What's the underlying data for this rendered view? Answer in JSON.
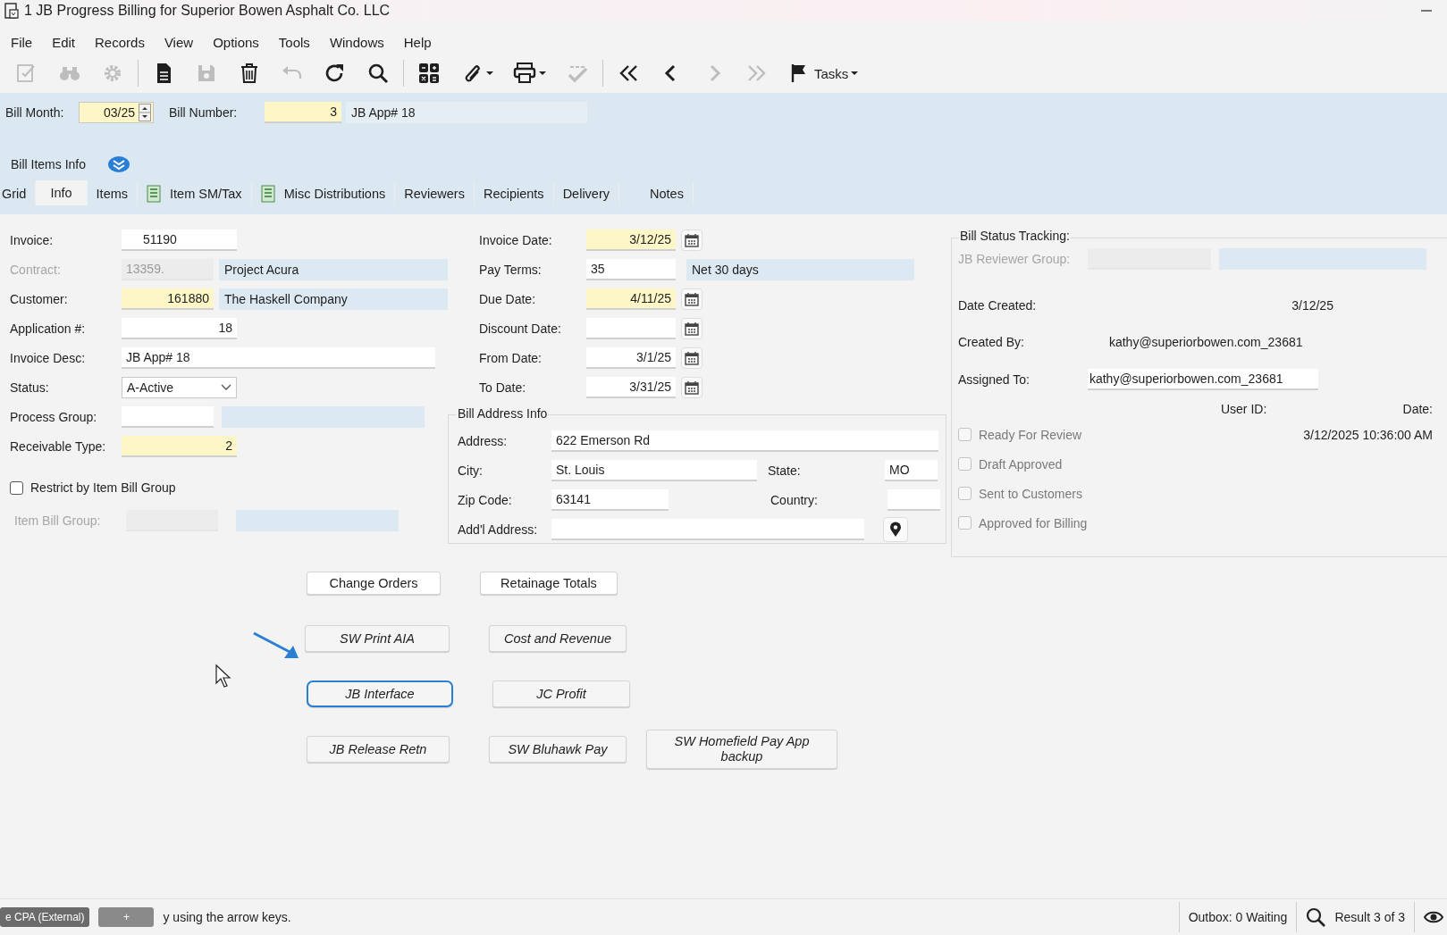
{
  "window": {
    "title": "1 JB Progress Billing for Superior Bowen  Asphalt Co. LLC"
  },
  "menu": [
    "File",
    "Edit",
    "Records",
    "View",
    "Options",
    "Tools",
    "Windows",
    "Help"
  ],
  "toolbar": [
    {
      "kind": "edit",
      "disabled": true,
      "dropdown": false
    },
    {
      "kind": "binoculars",
      "disabled": true,
      "dropdown": false
    },
    {
      "kind": "gear",
      "disabled": true,
      "dropdown": false
    },
    {
      "kind": "separator"
    },
    {
      "kind": "document",
      "disabled": false,
      "dropdown": false
    },
    {
      "kind": "save",
      "disabled": true,
      "dropdown": false
    },
    {
      "kind": "trash",
      "disabled": false,
      "dropdown": false
    },
    {
      "kind": "undo",
      "disabled": true,
      "dropdown": false
    },
    {
      "kind": "refresh",
      "disabled": false,
      "dropdown": false
    },
    {
      "kind": "search",
      "disabled": false,
      "dropdown": false
    },
    {
      "kind": "separator"
    },
    {
      "kind": "calculator",
      "disabled": false,
      "dropdown": false
    },
    {
      "kind": "attach",
      "disabled": false,
      "dropdown": true
    },
    {
      "kind": "print",
      "disabled": false,
      "dropdown": true
    },
    {
      "kind": "spellcheck",
      "disabled": true,
      "dropdown": false
    },
    {
      "kind": "separator"
    },
    {
      "kind": "first",
      "disabled": false,
      "dropdown": false
    },
    {
      "kind": "previous",
      "disabled": false,
      "dropdown": false
    },
    {
      "kind": "next",
      "disabled": true,
      "dropdown": false
    },
    {
      "kind": "last",
      "disabled": true,
      "dropdown": false
    },
    {
      "kind": "tasks",
      "label": "Tasks",
      "disabled": false,
      "dropdown": true
    }
  ],
  "header": {
    "bill_month": {
      "label": "Bill Month:",
      "value": "03/25"
    },
    "bill_number": {
      "label": "Bill Number:",
      "value": "3"
    },
    "description": "JB App# 18"
  },
  "section": {
    "title": "Bill Items Info"
  },
  "tabs": [
    {
      "label": "Grid",
      "selected": false,
      "icon": false
    },
    {
      "label": "Info",
      "selected": true,
      "icon": false
    },
    {
      "label": "Items",
      "selected": false,
      "icon": false
    },
    {
      "label": "Item SM/Tax",
      "selected": false,
      "icon": true
    },
    {
      "label": "Misc Distributions",
      "selected": false,
      "icon": true
    },
    {
      "label": "Reviewers",
      "selected": false,
      "icon": false
    },
    {
      "label": "Recipients",
      "selected": false,
      "icon": false
    },
    {
      "label": "Delivery",
      "selected": false,
      "icon": false
    },
    {
      "label": "Notes",
      "selected": false,
      "icon": false
    }
  ],
  "left_fields": [
    {
      "label": "Invoice:",
      "kind": "code",
      "value": "51190",
      "required": false,
      "disabled": false,
      "lookup": false
    },
    {
      "label": "Contract:",
      "kind": "text",
      "value": "13359.",
      "required": false,
      "disabled": true,
      "lookup": true,
      "description": "Project Acura"
    },
    {
      "label": "Customer:",
      "kind": "number",
      "value": "161880",
      "required": true,
      "disabled": false,
      "lookup": true,
      "description": "The Haskell Company"
    },
    {
      "label": "Application #:",
      "kind": "number",
      "value": "18",
      "required": false,
      "disabled": false,
      "lookup": false
    },
    {
      "label": "Invoice Desc:",
      "kind": "wide",
      "value": "JB App# 18",
      "required": false,
      "disabled": false,
      "lookup": false
    },
    {
      "label": "Status:",
      "kind": "select",
      "value": "A-Active",
      "required": false,
      "disabled": false,
      "lookup": false
    },
    {
      "label": "Process Group:",
      "required": false,
      "disabled": false,
      "lookup": true
    },
    {
      "label": "Receivable Type:",
      "kind": "number",
      "value": "2",
      "required": true,
      "disabled": false,
      "lookup": false
    }
  ],
  "restrict": {
    "label": "Restrict by Item Bill Group",
    "checked": false
  },
  "lower_fields": [
    {
      "label": "Item Bill Group:",
      "required": false,
      "disabled": true,
      "lookup": true
    }
  ],
  "middle_fields": [
    {
      "label": "Invoice Date:",
      "kind": "date",
      "value": "3/12/25",
      "required": true
    },
    {
      "label": "Pay Terms:",
      "kind": "text",
      "value": "35",
      "required": false,
      "description": "Net 30 days"
    },
    {
      "label": "Due Date:",
      "kind": "date",
      "value": "4/11/25",
      "required": true
    },
    {
      "label": "Discount Date:",
      "kind": "date",
      "required": false
    },
    {
      "label": "From Date:",
      "kind": "date",
      "value": "3/1/25",
      "required": false
    },
    {
      "label": "To Date:",
      "kind": "date",
      "value": "3/31/25",
      "required": false
    }
  ],
  "bill_address": {
    "title": "Bill Address Info",
    "address": {
      "label": "Address:",
      "value": "622 Emerson Rd"
    },
    "city": {
      "label": "City:",
      "value": "St. Louis"
    },
    "state": {
      "label": "State:",
      "value": "MO"
    },
    "zip": {
      "label": "Zip Code:",
      "value": "63141"
    },
    "country": {
      "label": "Country:"
    },
    "addl_address": {
      "label": "Add'l Address:"
    }
  },
  "status_tracking": {
    "title": "Bill Status Tracking:",
    "reviewer_group": {
      "label": "JB Reviewer Group:",
      "disabled": true
    },
    "date_created": {
      "label": "Date Created:",
      "value": "3/12/25"
    },
    "created_by": {
      "label": "Created By:",
      "value": "kathy@superiorbowen.com_23681"
    },
    "assigned_to": {
      "label": "Assigned To:",
      "value": "kathy@superiorbowen.com_23681"
    },
    "columns": [
      "User ID:",
      "Date:"
    ],
    "checks": [
      {
        "label": "Ready For Review",
        "checked": false,
        "disabled": true,
        "date": "3/12/2025 10:36:00 AM"
      },
      {
        "label": "Draft Approved",
        "checked": false,
        "disabled": true
      },
      {
        "label": "Sent to Customers",
        "checked": false,
        "disabled": true
      },
      {
        "label": "Approved for Billing",
        "checked": false,
        "disabled": true
      }
    ]
  },
  "buttons": [
    [
      {
        "label": "Change Orders",
        "kind": "standard",
        "focused": false
      },
      {
        "label": "Retainage Totals",
        "kind": "standard",
        "focused": false
      }
    ],
    [
      {
        "label": "SW Print AIA",
        "kind": "custom",
        "focused": false
      },
      {
        "label": "Cost and Revenue",
        "kind": "custom",
        "focused": false
      }
    ],
    [
      {
        "label": "JB Interface",
        "kind": "custom",
        "focused": true
      },
      {
        "label": "JC Profit",
        "kind": "custom",
        "focused": false
      }
    ],
    [
      {
        "label": "JB Release Retn",
        "kind": "custom",
        "focused": false
      },
      {
        "label": "SW Bluhawk Pay",
        "kind": "custom",
        "focused": false
      },
      {
        "label": "SW Homefield Pay App backup",
        "kind": "custom",
        "focused": false
      }
    ]
  ],
  "status_bar": {
    "chips": [
      "e CPA (External)",
      "+"
    ],
    "hint": "y using the arrow keys.",
    "outbox": "Outbox: 0 Waiting",
    "result": "Result 3 of 3"
  }
}
